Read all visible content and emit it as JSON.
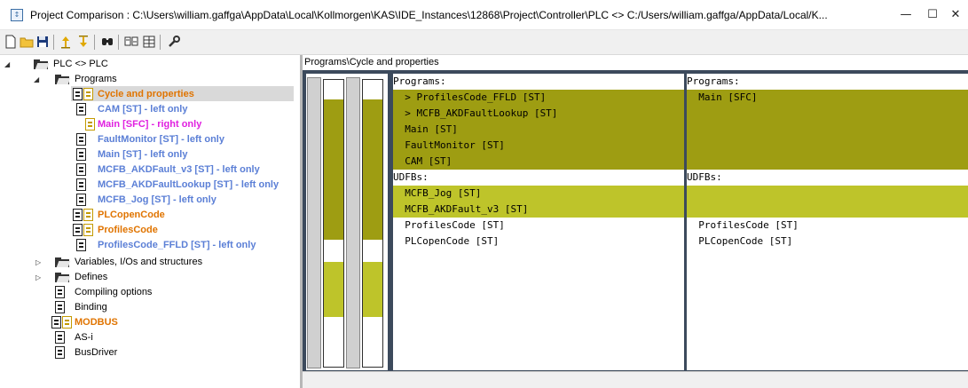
{
  "window": {
    "title": "Project Comparison : C:\\Users\\william.gaffga\\AppData\\Local\\Kollmorgen\\KAS\\IDE_Instances\\12868\\Project\\Controller\\PLC <> C:/Users/william.gaffga/AppData/Local/K...",
    "minimize": "—",
    "maximize": "☐",
    "close": "✕"
  },
  "tree": {
    "root": "PLC <> PLC",
    "programs_folder": "Programs",
    "programs": [
      {
        "label": "Cycle and properties",
        "color": "#e07400",
        "status": "changed"
      },
      {
        "label": "CAM [ST] - left only",
        "color": "#5b7fd6",
        "status": "left-only"
      },
      {
        "label": "Main [SFC] - right only",
        "color": "#e020e0",
        "status": "right-only"
      },
      {
        "label": "FaultMonitor [ST] - left only",
        "color": "#5b7fd6",
        "status": "left-only"
      },
      {
        "label": "Main [ST] - left only",
        "color": "#5b7fd6",
        "status": "left-only"
      },
      {
        "label": "MCFB_AKDFault_v3 [ST] - left only",
        "color": "#5b7fd6",
        "status": "left-only"
      },
      {
        "label": "MCFB_AKDFaultLookup [ST] - left only",
        "color": "#5b7fd6",
        "status": "left-only"
      },
      {
        "label": "MCFB_Jog [ST] - left only",
        "color": "#5b7fd6",
        "status": "left-only"
      },
      {
        "label": "PLCopenCode",
        "color": "#e07400",
        "status": "changed"
      },
      {
        "label": "ProfilesCode",
        "color": "#e07400",
        "status": "changed"
      },
      {
        "label": "ProfilesCode_FFLD [ST] - left only",
        "color": "#5b7fd6",
        "status": "left-only"
      }
    ],
    "folders": [
      "Variables, I/Os and structures",
      "Defines"
    ],
    "items": [
      {
        "label": "Compiling options",
        "color": "#000000"
      },
      {
        "label": "Binding",
        "color": "#000000"
      },
      {
        "label": "MODBUS",
        "color": "#e07400"
      },
      {
        "label": "AS-i",
        "color": "#000000"
      },
      {
        "label": "BusDriver",
        "color": "#000000"
      }
    ]
  },
  "compare": {
    "path": "Programs\\Cycle and properties",
    "left": {
      "lines": [
        {
          "text": "Programs:",
          "hl": ""
        },
        {
          "text": "  > ProfilesCode_FFLD [ST]",
          "hl": "dark"
        },
        {
          "text": "  > MCFB_AKDFaultLookup [ST]",
          "hl": "dark"
        },
        {
          "text": "  Main [ST]",
          "hl": "dark"
        },
        {
          "text": "  FaultMonitor [ST]",
          "hl": "dark"
        },
        {
          "text": "  CAM [ST]",
          "hl": "dark"
        },
        {
          "text": "UDFBs:",
          "hl": ""
        },
        {
          "text": "  MCFB_Jog [ST]",
          "hl": "light"
        },
        {
          "text": "  MCFB_AKDFault_v3 [ST]",
          "hl": "light"
        },
        {
          "text": "  ProfilesCode [ST]",
          "hl": ""
        },
        {
          "text": "  PLCopenCode [ST]",
          "hl": ""
        }
      ]
    },
    "right": {
      "lines": [
        {
          "text": "Programs:",
          "hl": ""
        },
        {
          "text": "  Main [SFC]",
          "hl": "dark"
        },
        {
          "text": "",
          "hl": "dark"
        },
        {
          "text": "",
          "hl": "dark"
        },
        {
          "text": "",
          "hl": "dark"
        },
        {
          "text": "",
          "hl": "dark"
        },
        {
          "text": "UDFBs:",
          "hl": ""
        },
        {
          "text": "",
          "hl": "light"
        },
        {
          "text": "",
          "hl": "light"
        },
        {
          "text": "  ProfilesCode [ST]",
          "hl": ""
        },
        {
          "text": "  PLCopenCode [ST]",
          "hl": ""
        }
      ]
    },
    "colors": {
      "changed_dark": "#9e9d12",
      "changed_light": "#bec42a",
      "pane_bg": "#3c4a5c"
    }
  },
  "toolbar_icons": [
    "new-icon",
    "open-folder-icon",
    "save-icon",
    "previous-difference-icon",
    "next-difference-icon",
    "find-icon",
    "compare-icon",
    "grid-icon",
    "settings-wrench-icon"
  ]
}
